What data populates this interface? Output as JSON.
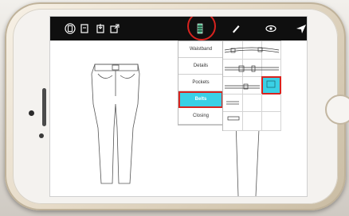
{
  "toolbar": {
    "icons": [
      "file-icon",
      "new-page-icon",
      "import-icon",
      "export-icon",
      "library-icon",
      "pencil-icon",
      "eye-icon",
      "send-icon"
    ],
    "active": "library-icon"
  },
  "menu": {
    "items": [
      {
        "label": "Waistband"
      },
      {
        "label": "Details"
      },
      {
        "label": "Pockets"
      },
      {
        "label": "Belts",
        "selected": true
      },
      {
        "label": "Closing"
      }
    ]
  },
  "grid": {
    "selected_cell": "belt-loop-cell"
  }
}
